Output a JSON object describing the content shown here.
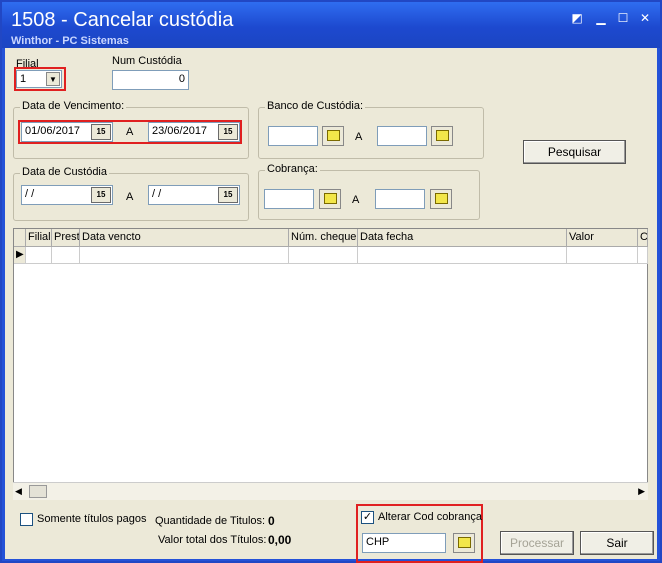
{
  "window": {
    "title": "1508 - Cancelar custódia",
    "subtitle": "Winthor - PC Sistemas"
  },
  "filial": {
    "label": "Filial",
    "value": "1"
  },
  "num_custodia": {
    "label": "Num Custódia",
    "value": "0"
  },
  "data_vencimento": {
    "label": "Data de Vencimento:",
    "from": "01/06/2017",
    "to": "23/06/2017",
    "sep": "A"
  },
  "banco_custodia": {
    "label": "Banco de Custódia:",
    "sep": "A",
    "from": "",
    "to": ""
  },
  "data_custodia": {
    "label": "Data de Custódia",
    "from": " /  /",
    "to": " /  /",
    "sep": "A"
  },
  "cobranca": {
    "label": "Cobrança:",
    "sep": "A",
    "from": "",
    "to": ""
  },
  "pesquisar_label": "Pesquisar",
  "calendar_icon_text": "15",
  "grid": {
    "columns": [
      "Filial",
      "Prest",
      "Data vencto",
      "Núm. cheque",
      "Data fecha",
      "Valor",
      "C"
    ]
  },
  "bottom": {
    "somente_titulos_pagos": "Somente títulos pagos",
    "quantidade_label": "Quantidade de Titulos:",
    "quantidade_value": "0",
    "valor_total_label": "Valor total dos Títulos:",
    "valor_total_value": "0,00",
    "alterar_cod_cobranca": "Alterar Cod cobrança",
    "cod_cobranca_value": "CHP",
    "processar_label": "Processar",
    "sair_label": "Sair"
  }
}
